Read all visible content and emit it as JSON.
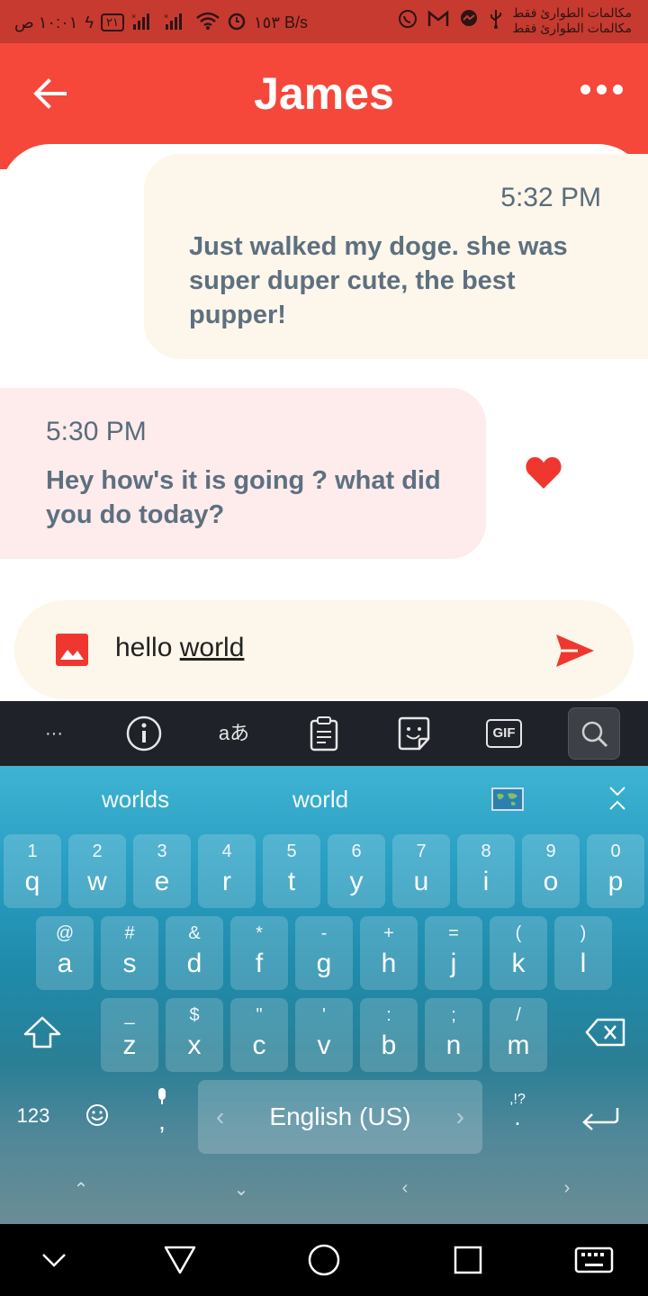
{
  "status_bar": {
    "carrier_line_1": "مكالمات الطوارئ فقط",
    "carrier_line_2": "مكالمات الطوارئ فقط",
    "time": "١٠:٠١ ص",
    "speed": "١٥٣ B/s",
    "battery": "٢١"
  },
  "header": {
    "title": "James"
  },
  "messages": [
    {
      "time": "5:32 PM",
      "text": "Just walked my doge. she was super duper cute, the best pupper!"
    },
    {
      "time": "5:30 PM",
      "text": "Hey how's it is going ? what did you do today?"
    }
  ],
  "input": {
    "text_plain": "hello ",
    "text_underlined": "world"
  },
  "keyboard": {
    "toolbar": {
      "gif_label": "GIF",
      "ellipsis": "···",
      "translate_label": "aあ"
    },
    "suggestions": [
      "worlds",
      "world"
    ],
    "row1": [
      {
        "sup": "1",
        "main": "q"
      },
      {
        "sup": "2",
        "main": "w"
      },
      {
        "sup": "3",
        "main": "e"
      },
      {
        "sup": "4",
        "main": "r"
      },
      {
        "sup": "5",
        "main": "t"
      },
      {
        "sup": "6",
        "main": "y"
      },
      {
        "sup": "7",
        "main": "u"
      },
      {
        "sup": "8",
        "main": "i"
      },
      {
        "sup": "9",
        "main": "o"
      },
      {
        "sup": "0",
        "main": "p"
      }
    ],
    "row2": [
      {
        "sup": "@",
        "main": "a"
      },
      {
        "sup": "#",
        "main": "s"
      },
      {
        "sup": "&",
        "main": "d"
      },
      {
        "sup": "*",
        "main": "f"
      },
      {
        "sup": "-",
        "main": "g"
      },
      {
        "sup": "+",
        "main": "h"
      },
      {
        "sup": "=",
        "main": "j"
      },
      {
        "sup": "(",
        "main": "k"
      },
      {
        "sup": ")",
        "main": "l"
      }
    ],
    "row3": [
      {
        "sup": "_",
        "main": "z"
      },
      {
        "sup": "$",
        "main": "x"
      },
      {
        "sup": "\"",
        "main": "c"
      },
      {
        "sup": "'",
        "main": "v"
      },
      {
        "sup": ":",
        "main": "b"
      },
      {
        "sup": ";",
        "main": "n"
      },
      {
        "sup": "/",
        "main": "m"
      }
    ],
    "numbers_key": "123",
    "comma_key": ",",
    "punct_key_sup": ",!?",
    "punct_key_main": ".",
    "space_label": "English (US)"
  }
}
